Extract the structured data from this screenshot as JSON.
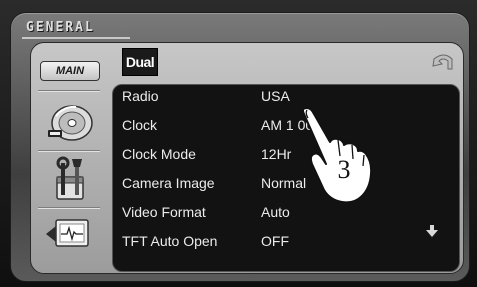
{
  "window": {
    "section_tab": "GENERAL",
    "brand_logo": "Dual"
  },
  "sidebar": {
    "main_label": "MAIN",
    "items": [
      {
        "name": "disc-media",
        "icon": "disc-icon"
      },
      {
        "name": "setup-tools",
        "icon": "tools-icon"
      },
      {
        "name": "monitor-heartbeat",
        "icon": "monitor-pulse-icon"
      }
    ]
  },
  "settings": [
    {
      "label": "Radio",
      "value": "USA"
    },
    {
      "label": "Clock",
      "value": "AM 1  00"
    },
    {
      "label": "Clock Mode",
      "value": "12Hr"
    },
    {
      "label": "Camera Image",
      "value": "Normal"
    },
    {
      "label": "Video Format",
      "value": "Auto"
    },
    {
      "label": "TFT Auto Open",
      "value": "OFF"
    }
  ],
  "overlay": {
    "step_number": "3",
    "pointer_icon": "hand-pointer-icon"
  },
  "colors": {
    "list_background": "#121212",
    "text": "#ececec",
    "frame": "#5a5a5a"
  }
}
